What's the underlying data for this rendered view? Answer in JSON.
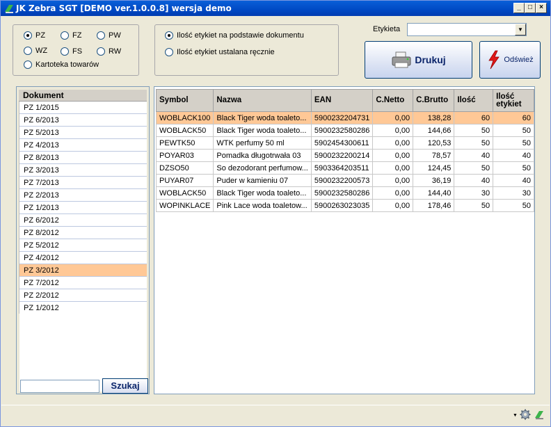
{
  "window": {
    "title": "JK Zebra SGT [DEMO ver.1.0.0.8]  wersja demo"
  },
  "doc_types": [
    {
      "label": "PZ",
      "checked": true
    },
    {
      "label": "FZ",
      "checked": false
    },
    {
      "label": "PW",
      "checked": false
    },
    {
      "label": "WZ",
      "checked": false
    },
    {
      "label": "FS",
      "checked": false
    },
    {
      "label": "RW",
      "checked": false
    },
    {
      "label": "Kartoteka towarów",
      "checked": false
    }
  ],
  "label_mode": [
    {
      "label": "Ilość etykiet na podstawie dokumentu",
      "checked": true
    },
    {
      "label": "Ilość etykiet ustalana ręcznie",
      "checked": false
    }
  ],
  "etykieta": {
    "label": "Etykieta",
    "value": ""
  },
  "buttons": {
    "print": "Drukuj",
    "refresh": "Odśwież",
    "search": "Szukaj"
  },
  "documents": {
    "header": "Dokument",
    "items": [
      "PZ 1/2015",
      "PZ 6/2013",
      "PZ 5/2013",
      "PZ 4/2013",
      "PZ 8/2013",
      "PZ 3/2013",
      "PZ 7/2013",
      "PZ 2/2013",
      "PZ 1/2013",
      "PZ 6/2012",
      "PZ 8/2012",
      "PZ 5/2012",
      "PZ 4/2012",
      "PZ 3/2012",
      "PZ 7/2012",
      "PZ 2/2012",
      "PZ 1/2012"
    ],
    "selected": 13
  },
  "search": {
    "value": ""
  },
  "table": {
    "columns": [
      "Symbol",
      "Nazwa",
      "EAN",
      "C.Netto",
      "C.Brutto",
      "Ilość",
      "Ilość etykiet"
    ],
    "selected": 0,
    "rows": [
      [
        "WOBLACK100",
        "Black Tiger woda toaleto...",
        "5900232204731",
        "0,00",
        "138,28",
        "60",
        "60"
      ],
      [
        "WOBLACK50",
        "Black Tiger woda toaleto...",
        "5900232580286",
        "0,00",
        "144,66",
        "50",
        "50"
      ],
      [
        "PEWTK50",
        "WTK perfumy 50 ml",
        "5902454300611",
        "0,00",
        "120,53",
        "50",
        "50"
      ],
      [
        "POYAR03",
        "Pomadka długotrwała 03",
        "5900232200214",
        "0,00",
        "78,57",
        "40",
        "40"
      ],
      [
        "DZSO50",
        "So dezodorant perfumow...",
        "5903364203511",
        "0,00",
        "124,45",
        "50",
        "50"
      ],
      [
        "PUYAR07",
        "Puder w kamieniu 07",
        "5900232200573",
        "0,00",
        "36,19",
        "40",
        "40"
      ],
      [
        "WOBLACK50",
        "Black Tiger woda toaleto...",
        "5900232580286",
        "0,00",
        "144,40",
        "30",
        "30"
      ],
      [
        "WOPINKLACE",
        "Pink Lace woda toaletow...",
        "5900263023035",
        "0,00",
        "178,46",
        "50",
        "50"
      ]
    ]
  }
}
